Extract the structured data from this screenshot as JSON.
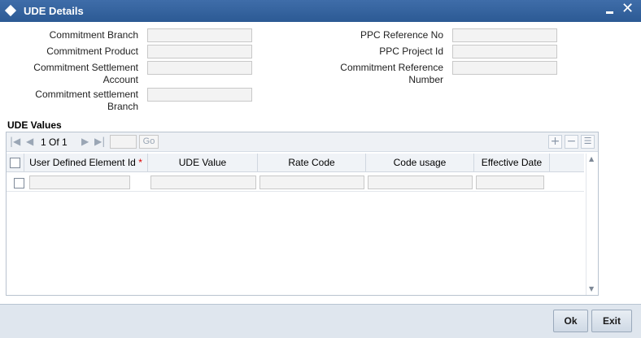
{
  "window": {
    "title": "UDE Details"
  },
  "form": {
    "commitment_branch": {
      "label": "Commitment Branch",
      "value": ""
    },
    "commitment_product": {
      "label": "Commitment Product",
      "value": ""
    },
    "commitment_settlement_account": {
      "label_line1": "Commitment Settlement",
      "label_line2": "Account",
      "value": ""
    },
    "commitment_settlement_branch": {
      "label_line1": "Commitment settlement",
      "label_line2": "Branch",
      "value": ""
    },
    "ppc_reference_no": {
      "label": "PPC Reference No",
      "value": ""
    },
    "ppc_project_id": {
      "label": "PPC Project Id",
      "value": ""
    },
    "commitment_reference_number": {
      "label_line1": "Commitment Reference",
      "label_line2": "Number",
      "value": ""
    }
  },
  "ude_values": {
    "section_title": "UDE Values",
    "pagination": {
      "current": "1",
      "of_label": "Of",
      "total": "1",
      "go_label": "Go"
    },
    "columns": [
      "User Defined Element Id",
      "UDE Value",
      "Rate Code",
      "Code usage",
      "Effective Date"
    ],
    "required_marker": "*",
    "rows": [
      {
        "user_defined_element_id": "",
        "ude_value": "",
        "rate_code": "",
        "code_usage": "",
        "effective_date": ""
      }
    ]
  },
  "footer": {
    "ok_label": "Ok",
    "exit_label": "Exit"
  },
  "icons": {
    "window": "diamond-icon",
    "minimize": "minimize-icon",
    "close": "close-icon",
    "first": "first-page-icon",
    "prev": "prev-page-icon",
    "next": "next-page-icon",
    "last": "last-page-icon",
    "add": "add-row-icon",
    "delete": "delete-row-icon",
    "single_view": "single-record-view-icon"
  },
  "colors": {
    "titlebar": "#2c5a94",
    "required": "#dd0000",
    "footer": "#dfe6ee"
  }
}
